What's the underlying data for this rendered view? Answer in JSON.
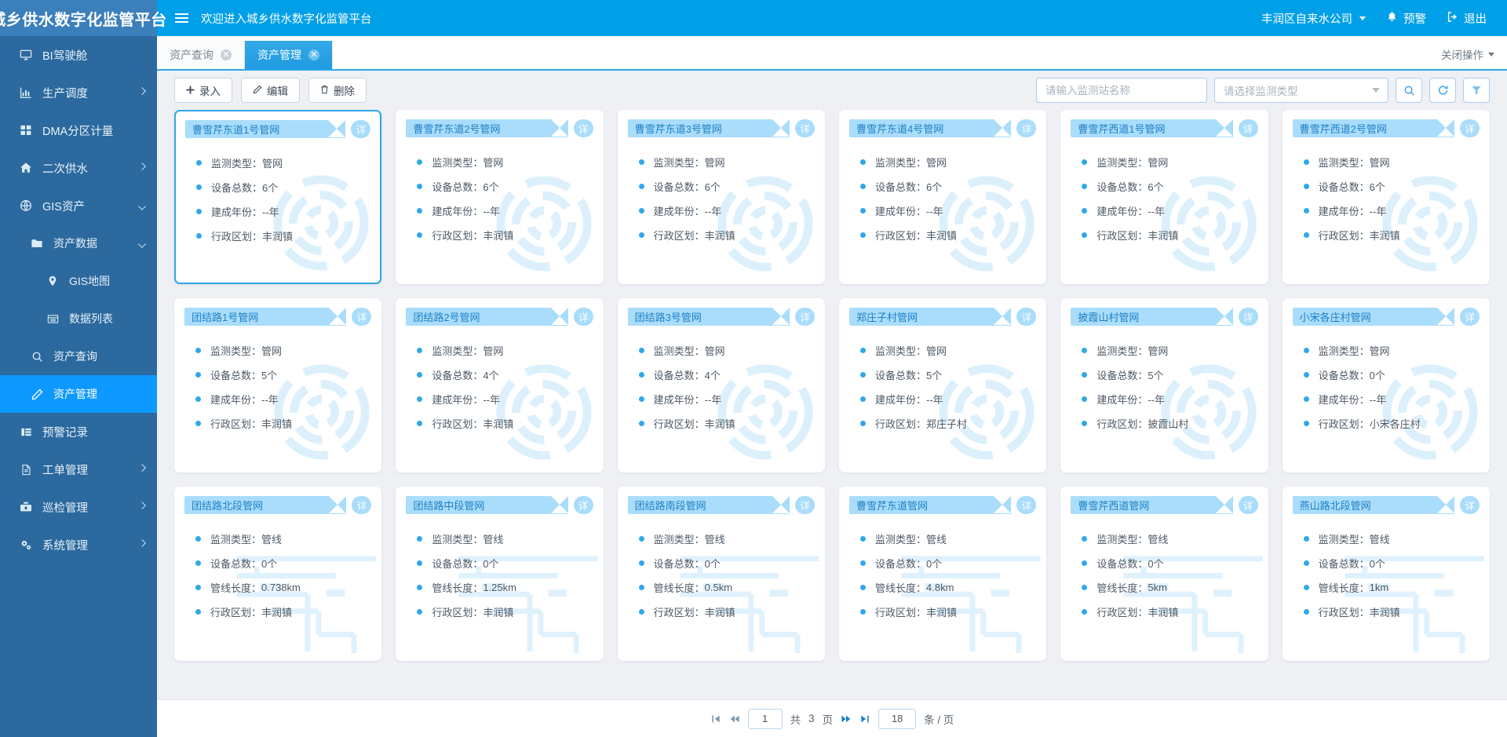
{
  "header": {
    "brand_title": "城乡供水数字化监管平台",
    "menu_icon": "hamburger-icon",
    "welcome": "欢迎进入城乡供水数字化监管平台",
    "company": "丰润区自来水公司",
    "alarm": "预警",
    "logout": "退出"
  },
  "sidebar": {
    "items": [
      {
        "label": "BI驾驶舱",
        "icon": "monitor-icon",
        "level": 1,
        "arrow": "none",
        "active": false
      },
      {
        "label": "生产调度",
        "icon": "chart-bar-icon",
        "level": 1,
        "arrow": "right",
        "active": false
      },
      {
        "label": "DMA分区计量",
        "icon": "grid-icon",
        "level": 1,
        "arrow": "none",
        "active": false
      },
      {
        "label": "二次供水",
        "icon": "home-icon",
        "level": 1,
        "arrow": "right",
        "active": false
      },
      {
        "label": "GIS资产",
        "icon": "globe-icon",
        "level": 1,
        "arrow": "down",
        "active": false
      },
      {
        "label": "资产数据",
        "icon": "folder-icon",
        "level": 2,
        "arrow": "down",
        "active": false
      },
      {
        "label": "GIS地图",
        "icon": "pin-icon",
        "level": 3,
        "arrow": "none",
        "active": false
      },
      {
        "label": "数据列表",
        "icon": "list-icon",
        "level": 3,
        "arrow": "none",
        "active": false
      },
      {
        "label": "资产查询",
        "icon": "search-icon",
        "level": 2,
        "arrow": "none",
        "active": false
      },
      {
        "label": "资产管理",
        "icon": "pencil-icon",
        "level": 2,
        "arrow": "none",
        "active": true
      },
      {
        "label": "预警记录",
        "icon": "table-icon",
        "level": 1,
        "arrow": "none",
        "active": false
      },
      {
        "label": "工单管理",
        "icon": "document-icon",
        "level": 1,
        "arrow": "right",
        "active": false
      },
      {
        "label": "巡检管理",
        "icon": "toolbox-icon",
        "level": 1,
        "arrow": "right",
        "active": false
      },
      {
        "label": "系统管理",
        "icon": "gears-icon",
        "level": 1,
        "arrow": "right",
        "active": false
      }
    ]
  },
  "tabs": {
    "items": [
      {
        "label": "资产查询",
        "active": false
      },
      {
        "label": "资产管理",
        "active": true
      }
    ],
    "close_ops": "关闭操作"
  },
  "toolbar": {
    "add_label": "录入",
    "edit_label": "编辑",
    "delete_label": "删除",
    "search_placeholder": "请输入监测站名称",
    "search_value": "",
    "type_select_placeholder": "请选择监测类型",
    "search_icon": "magnifier-icon",
    "refresh_icon": "refresh-icon",
    "filter_icon": "funnel-icon"
  },
  "card_fields": {
    "detail_label": "详",
    "type_label": "监测类型：",
    "device_label": "设备总数：",
    "year_label": "建成年份：",
    "length_label": "管线长度：",
    "region_label": "行政区划："
  },
  "cards": [
    {
      "title": "曹雪芹东道1号管网",
      "type": "管网",
      "devices": "6个",
      "third_label": "建成年份：",
      "third_value": "--年",
      "region": "丰润镇",
      "art": "pipe-network",
      "selected": true
    },
    {
      "title": "曹雪芹东道2号管网",
      "type": "管网",
      "devices": "6个",
      "third_label": "建成年份：",
      "third_value": "--年",
      "region": "丰润镇",
      "art": "pipe-network",
      "selected": false
    },
    {
      "title": "曹雪芹东道3号管网",
      "type": "管网",
      "devices": "6个",
      "third_label": "建成年份：",
      "third_value": "--年",
      "region": "丰润镇",
      "art": "pipe-network",
      "selected": false
    },
    {
      "title": "曹雪芹东道4号管网",
      "type": "管网",
      "devices": "6个",
      "third_label": "建成年份：",
      "third_value": "--年",
      "region": "丰润镇",
      "art": "pipe-network",
      "selected": false
    },
    {
      "title": "曹雪芹西道1号管网",
      "type": "管网",
      "devices": "6个",
      "third_label": "建成年份：",
      "third_value": "--年",
      "region": "丰润镇",
      "art": "pipe-network",
      "selected": false
    },
    {
      "title": "曹雪芹西道2号管网",
      "type": "管网",
      "devices": "6个",
      "third_label": "建成年份：",
      "third_value": "--年",
      "region": "丰润镇",
      "art": "pipe-network",
      "selected": false
    },
    {
      "title": "团结路1号管网",
      "type": "管网",
      "devices": "5个",
      "third_label": "建成年份：",
      "third_value": "--年",
      "region": "丰润镇",
      "art": "pipe-network",
      "selected": false
    },
    {
      "title": "团结路2号管网",
      "type": "管网",
      "devices": "4个",
      "third_label": "建成年份：",
      "third_value": "--年",
      "region": "丰润镇",
      "art": "pipe-network",
      "selected": false
    },
    {
      "title": "团结路3号管网",
      "type": "管网",
      "devices": "4个",
      "third_label": "建成年份：",
      "third_value": "--年",
      "region": "丰润镇",
      "art": "pipe-network",
      "selected": false
    },
    {
      "title": "郑庄子村管网",
      "type": "管网",
      "devices": "5个",
      "third_label": "建成年份：",
      "third_value": "--年",
      "region": "郑庄子村",
      "art": "pipe-network",
      "selected": false
    },
    {
      "title": "披霞山村管网",
      "type": "管网",
      "devices": "5个",
      "third_label": "建成年份：",
      "third_value": "--年",
      "region": "披霞山村",
      "art": "pipe-network",
      "selected": false
    },
    {
      "title": "小宋各庄村管网",
      "type": "管网",
      "devices": "0个",
      "third_label": "建成年份：",
      "third_value": "--年",
      "region": "小宋各庄村",
      "art": "pipe-network",
      "selected": false
    },
    {
      "title": "团结路北段管网",
      "type": "管线",
      "devices": "0个",
      "third_label": "管线长度：",
      "third_value": "0.738km",
      "region": "丰润镇",
      "art": "pipe-line",
      "selected": false
    },
    {
      "title": "团结路中段管网",
      "type": "管线",
      "devices": "0个",
      "third_label": "管线长度：",
      "third_value": "1.25km",
      "region": "丰润镇",
      "art": "pipe-line",
      "selected": false
    },
    {
      "title": "团结路南段管网",
      "type": "管线",
      "devices": "0个",
      "third_label": "管线长度：",
      "third_value": "0.5km",
      "region": "丰润镇",
      "art": "pipe-line",
      "selected": false
    },
    {
      "title": "曹雪芹东道管网",
      "type": "管线",
      "devices": "0个",
      "third_label": "管线长度：",
      "third_value": "4.8km",
      "region": "丰润镇",
      "art": "pipe-line",
      "selected": false
    },
    {
      "title": "曹雪芹西道管网",
      "type": "管线",
      "devices": "0个",
      "third_label": "管线长度：",
      "third_value": "5km",
      "region": "丰润镇",
      "art": "pipe-line",
      "selected": false
    },
    {
      "title": "燕山路北段管网",
      "type": "管线",
      "devices": "0个",
      "third_label": "管线长度：",
      "third_value": "1km",
      "region": "丰润镇",
      "art": "pipe-line",
      "selected": false
    }
  ],
  "pagination": {
    "first_icon": "first-page-icon",
    "prev_icon": "prev-page-icon",
    "current_page": "1",
    "total_prefix": "共",
    "total_pages": "3",
    "total_suffix": "页",
    "next_icon": "next-page-icon",
    "last_icon": "last-page-icon",
    "page_size": "18",
    "size_suffix": "条 / 页"
  },
  "colors": {
    "brand_blue": "#00a0e9",
    "sidebar_blue": "#2b699e",
    "active_blue": "#0d99ff",
    "ribbon_blue": "#a9ddfb",
    "accent": "#2fa8e8"
  }
}
